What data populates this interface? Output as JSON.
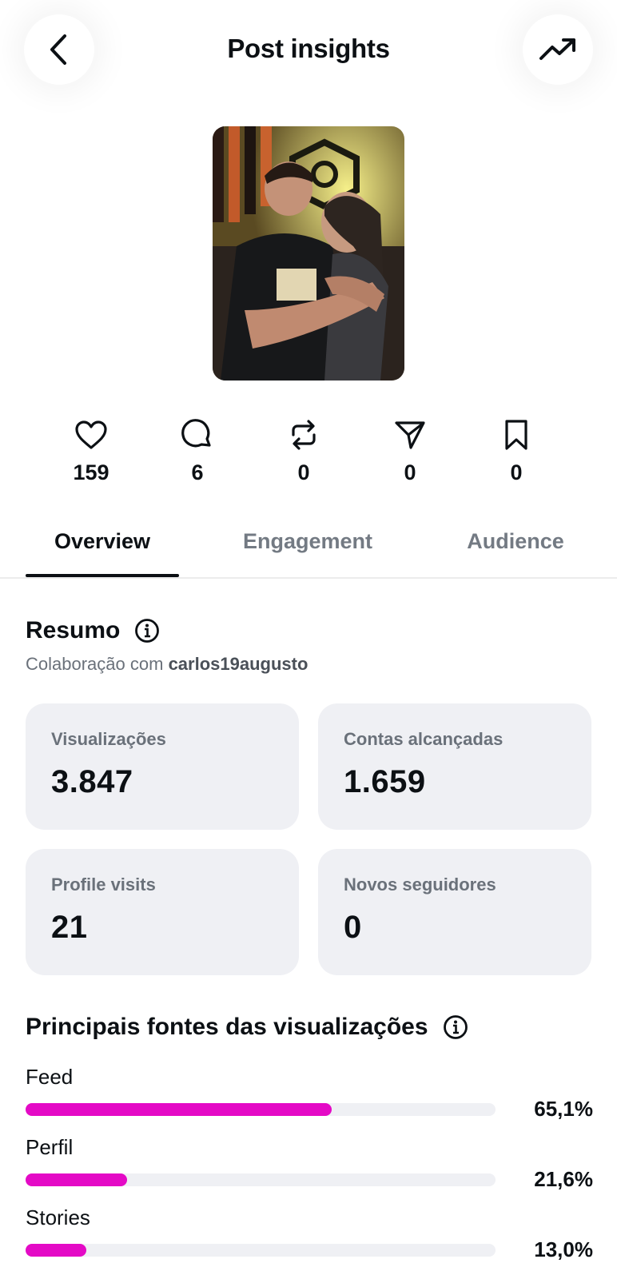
{
  "header": {
    "title": "Post insights",
    "back_icon": "chevron-left-icon",
    "trend_icon": "trending-up-icon"
  },
  "post": {
    "image_description_icon": "post-photo"
  },
  "stats": [
    {
      "icon": "heart-icon",
      "value": "159"
    },
    {
      "icon": "comment-icon",
      "value": "6"
    },
    {
      "icon": "repost-icon",
      "value": "0"
    },
    {
      "icon": "share-icon",
      "value": "0"
    },
    {
      "icon": "bookmark-icon",
      "value": "0"
    }
  ],
  "tabs": [
    {
      "label": "Overview",
      "active": true
    },
    {
      "label": "Engagement",
      "active": false
    },
    {
      "label": "Audience",
      "active": false
    }
  ],
  "summary": {
    "title": "Resumo",
    "collab_prefix": "Colaboração com",
    "collab_user": "carlos19augusto",
    "cards": [
      {
        "label": "Visualizações",
        "value": "3.847"
      },
      {
        "label": "Contas alcançadas",
        "value": "1.659"
      },
      {
        "label": "Profile visits",
        "value": "21"
      },
      {
        "label": "Novos seguidores",
        "value": "0"
      }
    ]
  },
  "sources": {
    "title": "Principais fontes das visualizações",
    "bar_color": "#e40ac6",
    "items": [
      {
        "name": "Feed",
        "percent_label": "65,1%",
        "fraction": 0.651
      },
      {
        "name": "Perfil",
        "percent_label": "21,6%",
        "fraction": 0.216
      },
      {
        "name": "Stories",
        "percent_label": "13,0%",
        "fraction": 0.13
      }
    ]
  }
}
